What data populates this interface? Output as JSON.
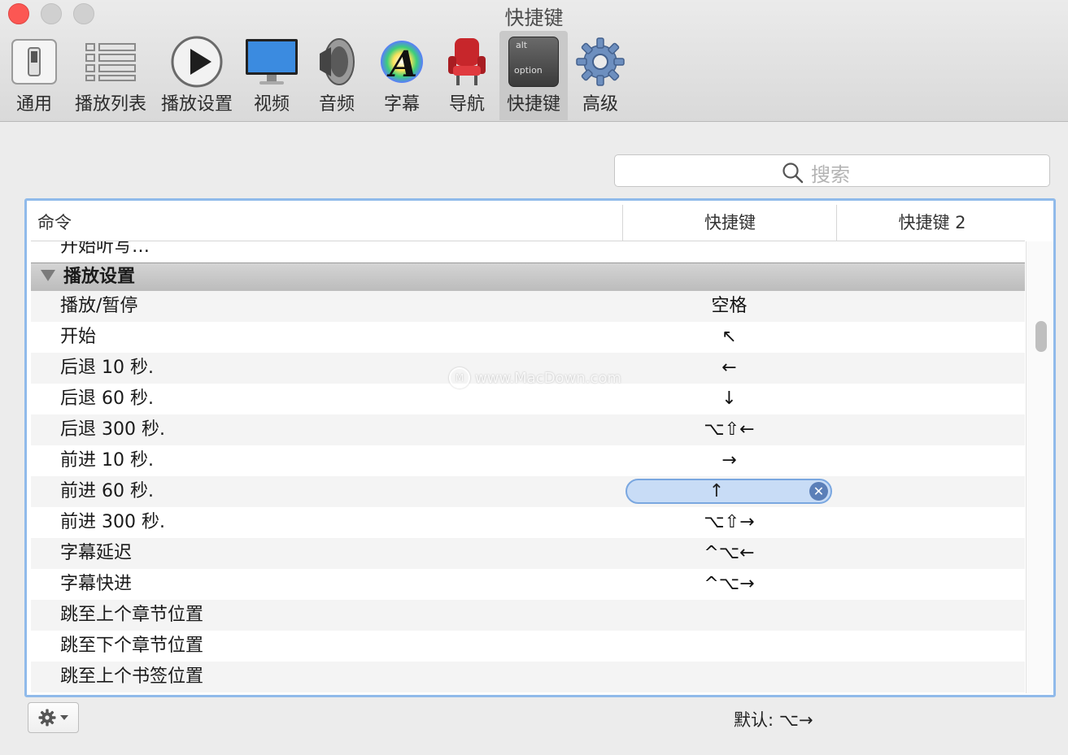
{
  "window": {
    "title": "快捷键"
  },
  "toolbar": {
    "items": [
      {
        "label": "通用",
        "icon": "switch-icon"
      },
      {
        "label": "播放列表",
        "icon": "list-icon"
      },
      {
        "label": "播放设置",
        "icon": "play-icon"
      },
      {
        "label": "视频",
        "icon": "monitor-icon"
      },
      {
        "label": "音频",
        "icon": "speaker-icon"
      },
      {
        "label": "字幕",
        "icon": "font-icon"
      },
      {
        "label": "导航",
        "icon": "seat-icon"
      },
      {
        "label": "快捷键",
        "icon": "option-key-icon",
        "active": true,
        "key_alt": "alt",
        "key_option": "option"
      },
      {
        "label": "高级",
        "icon": "gear-icon"
      }
    ]
  },
  "search": {
    "placeholder": "搜索"
  },
  "table": {
    "headers": {
      "command": "命令",
      "shortcut1": "快捷键",
      "shortcut2": "快捷键 2"
    },
    "partial_row": "开始听写…",
    "group": "播放设置",
    "rows": [
      {
        "command": "播放/暂停",
        "shortcut": "空格"
      },
      {
        "command": "开始",
        "shortcut": "↖"
      },
      {
        "command": "后退 10 秒.",
        "shortcut": "←"
      },
      {
        "command": "后退 60 秒.",
        "shortcut": "↓"
      },
      {
        "command": "后退 300 秒.",
        "shortcut": "⌥⇧←"
      },
      {
        "command": "前进 10 秒.",
        "shortcut": "→"
      },
      {
        "command": "前进 60 秒.",
        "shortcut": "↑",
        "editing": true
      },
      {
        "command": "前进 300 秒.",
        "shortcut": "⌥⇧→"
      },
      {
        "command": "字幕延迟",
        "shortcut": "^⌥←"
      },
      {
        "command": "字幕快进",
        "shortcut": "^⌥→"
      },
      {
        "command": "跳至上个章节位置",
        "shortcut": ""
      },
      {
        "command": "跳至下个章节位置",
        "shortcut": ""
      },
      {
        "command": "跳至上个书签位置",
        "shortcut": ""
      }
    ]
  },
  "watermark": "www.MacDown.com",
  "footer": {
    "default_label": "默认:  ⌥→"
  },
  "colors": {
    "accent": "#90baea",
    "close": "#fc5753",
    "pill": "#c8dcf6"
  }
}
